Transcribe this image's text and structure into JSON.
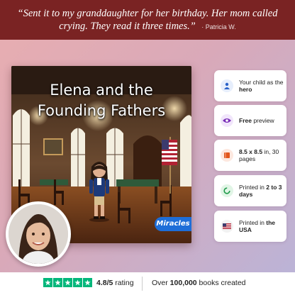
{
  "banner": {
    "quote": "“Sent it to my granddaughter for her birthday. Her mom called crying. They read it three times.”",
    "author": "· Patricia W."
  },
  "book": {
    "title_line1": "Elena and the",
    "title_line2": "Founding Fathers",
    "brand_badge": "Miracles"
  },
  "features": [
    {
      "icon": "person-icon",
      "pre": "Your child as the ",
      "bold": "hero",
      "post": ""
    },
    {
      "icon": "eye-icon",
      "pre": "",
      "bold": "Free",
      "post": " preview"
    },
    {
      "icon": "book-icon",
      "pre": "",
      "bold": "8.5 x 8.5",
      "post": " in, 30 pages"
    },
    {
      "icon": "clock-icon",
      "pre": "Printed in ",
      "bold": "2 to 3 days",
      "post": ""
    },
    {
      "icon": "us-flag-icon",
      "pre": "Printed in ",
      "bold": "the USA",
      "post": ""
    }
  ],
  "bottom": {
    "rating_value": "4.8/5",
    "rating_label": " rating",
    "created_pre": "Over ",
    "created_bold": "100,000",
    "created_post": " books created"
  },
  "colors": {
    "banner": "#7a2323",
    "trustpilot_green": "#00b67a",
    "brand_blue": "#1e6ed8"
  }
}
